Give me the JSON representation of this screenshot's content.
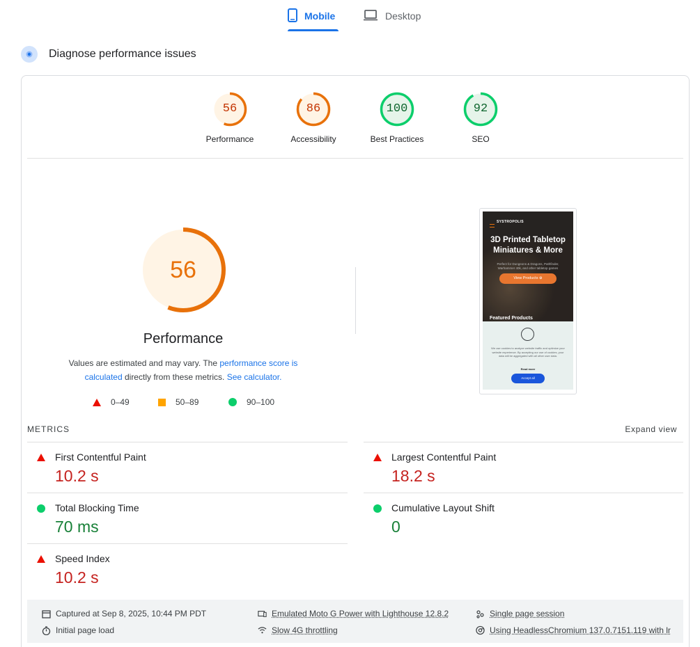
{
  "tabs": {
    "mobile": "Mobile",
    "desktop": "Desktop"
  },
  "header": {
    "title": "Diagnose performance issues"
  },
  "scores": [
    {
      "label": "Performance",
      "value": 56,
      "color": "#e8710a",
      "track": "#fff4e5"
    },
    {
      "label": "Accessibility",
      "value": 86,
      "color": "#e8710a",
      "track": "#fff4e5"
    },
    {
      "label": "Best Practices",
      "value": 100,
      "color": "#0cce6b",
      "track": "#e6f4ea"
    },
    {
      "label": "SEO",
      "value": 92,
      "color": "#0cce6b",
      "track": "#e6f4ea"
    }
  ],
  "main_score": {
    "value": "56",
    "fraction": 0.56,
    "label": "Performance",
    "desc_1": "Values are estimated and may vary. The ",
    "desc_link_1": "performance score is calculated",
    "desc_2": " directly from these metrics. ",
    "desc_link_2": "See calculator.",
    "color": "#e8710a"
  },
  "legend": {
    "red": "0–49",
    "orange": "50–89",
    "green": "90–100"
  },
  "screenshot": {
    "logo": "SYSTROPOLIS",
    "hero_title": "3D Printed Tabletop Miniatures & More",
    "hero_sub": "Perfect for Dungeons & Dragons, Pathfinder, Warhammer 40k, and other tabletop games",
    "hero_button": "View Products ⊕",
    "featured": "Featured Products",
    "cookie_text": "We use cookies to analyze website traffic and optimize your website experience. By accepting our use of cookies, your data will be aggregated with all other user data.",
    "read_more": "Read more",
    "accept": "Accept all"
  },
  "metrics": {
    "title": "METRICS",
    "expand": "Expand view",
    "fcp": {
      "label": "First Contentful Paint",
      "value": "10.2 s"
    },
    "lcp": {
      "label": "Largest Contentful Paint",
      "value": "18.2 s"
    },
    "tbt": {
      "label": "Total Blocking Time",
      "value": "70 ms"
    },
    "cls": {
      "label": "Cumulative Layout Shift",
      "value": "0"
    },
    "si": {
      "label": "Speed Index",
      "value": "10.2 s"
    }
  },
  "footer": {
    "captured": "Captured at Sep 8, 2025, 10:44 PM PDT",
    "initial": "Initial page load",
    "device": "Emulated Moto G Power with Lighthouse 12.8.2",
    "throttling": "Slow 4G throttling",
    "session": "Single page session",
    "browser": "Using HeadlessChromium 137.0.7151.119 with lr"
  }
}
